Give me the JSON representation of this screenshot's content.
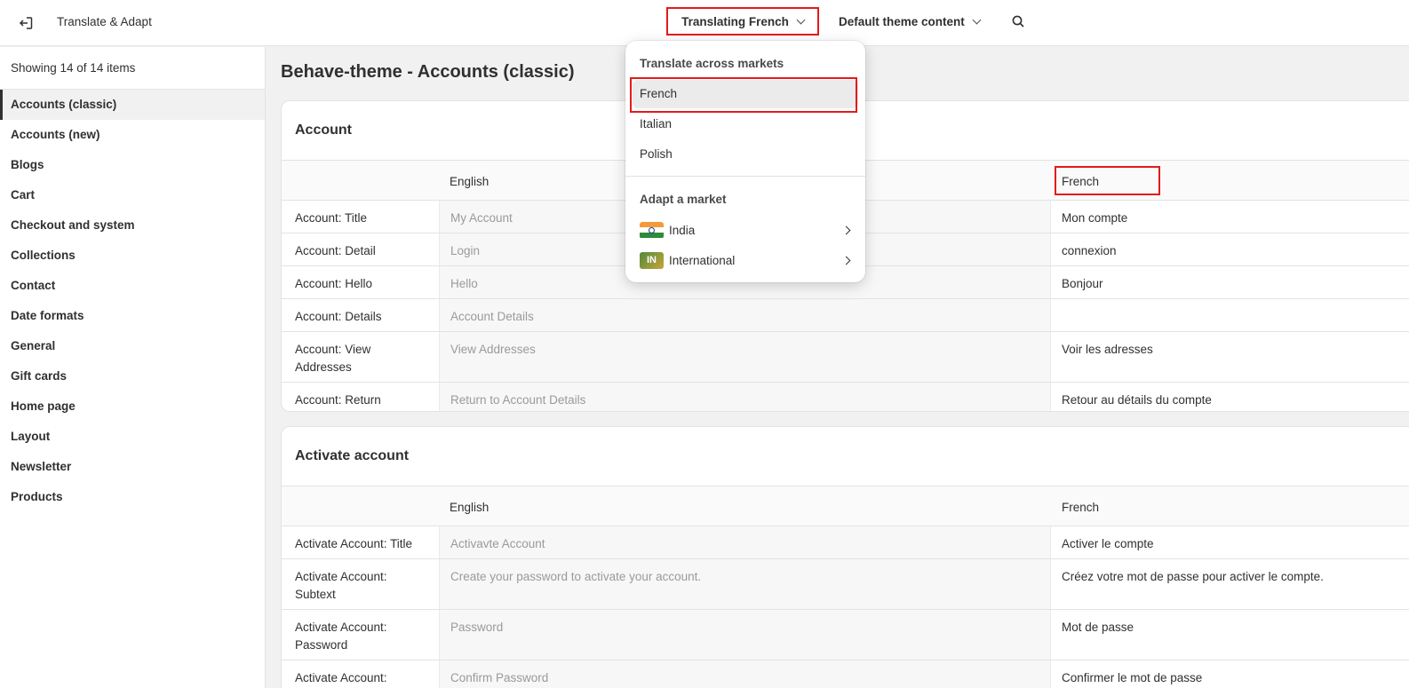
{
  "topbar": {
    "app_title": "Translate & Adapt",
    "language_button": "Translating French",
    "content_button": "Default theme content"
  },
  "sidebar": {
    "count_text": "Showing 14 of 14 items",
    "items": [
      {
        "label": "Accounts (classic)"
      },
      {
        "label": "Accounts (new)"
      },
      {
        "label": "Blogs"
      },
      {
        "label": "Cart"
      },
      {
        "label": "Checkout and system"
      },
      {
        "label": "Collections"
      },
      {
        "label": "Contact"
      },
      {
        "label": "Date formats"
      },
      {
        "label": "General"
      },
      {
        "label": "Gift cards"
      },
      {
        "label": "Home page"
      },
      {
        "label": "Layout"
      },
      {
        "label": "Newsletter"
      },
      {
        "label": "Products"
      }
    ]
  },
  "main": {
    "page_title": "Behave-theme - Accounts (classic)",
    "sections": [
      {
        "title": "Account",
        "col_english": "English",
        "col_target": "French",
        "rows": [
          {
            "key": "Account: Title",
            "english": "My Account",
            "translation": "Mon compte"
          },
          {
            "key": "Account: Detail",
            "english": "Login",
            "translation": "connexion"
          },
          {
            "key": "Account: Hello",
            "english": "Hello",
            "translation": "Bonjour"
          },
          {
            "key": "Account: Details",
            "english": "Account Details",
            "translation": ""
          },
          {
            "key": "Account: View Addresses",
            "english": "View Addresses",
            "translation": "Voir les adresses"
          },
          {
            "key": "Account: Return",
            "english": "Return to Account Details",
            "translation": "Retour au détails du compte"
          }
        ]
      },
      {
        "title": "Activate account",
        "col_english": "English",
        "col_target": "French",
        "rows": [
          {
            "key": "Activate Account: Title",
            "english": "Activavte Account",
            "translation": "Activer le compte"
          },
          {
            "key": "Activate Account: Subtext",
            "english": "Create your password to activate your account.",
            "translation": "Créez votre mot de passe pour activer le compte."
          },
          {
            "key": "Activate Account: Password",
            "english": "Password",
            "translation": "Mot de passe"
          },
          {
            "key": "Activate Account:",
            "english": "Confirm Password",
            "translation": "Confirmer le mot de passe"
          }
        ]
      }
    ]
  },
  "dropdown": {
    "heading_translate": "Translate across markets",
    "languages": [
      {
        "label": "French",
        "selected": true
      },
      {
        "label": "Italian"
      },
      {
        "label": "Polish"
      }
    ],
    "heading_adapt": "Adapt a market",
    "markets": [
      {
        "label": "India",
        "icon": "india-flag-icon"
      },
      {
        "label": "International",
        "badge": "IN",
        "icon": "international-flag-icon"
      }
    ]
  },
  "colors": {
    "highlight_red": "#e41a1a",
    "text": "#303030",
    "muted_text": "#9a9a9a",
    "background": "#f1f1f1"
  }
}
